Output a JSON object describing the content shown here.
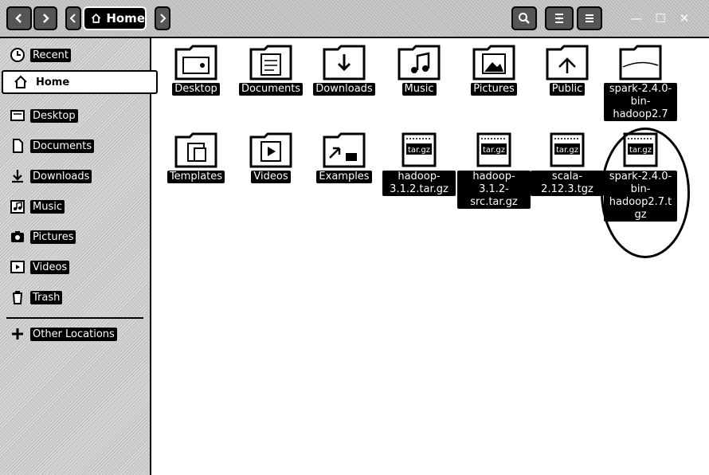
{
  "header": {
    "location_label": "Home",
    "window_controls": [
      "—",
      "☐",
      "✕"
    ]
  },
  "sidebar": {
    "items": [
      {
        "label": "Recent",
        "icon": "clock-icon"
      },
      {
        "label": "Home",
        "icon": "home-icon"
      },
      {
        "label": "Desktop",
        "icon": "desktop-folder-icon"
      },
      {
        "label": "Documents",
        "icon": "document-icon"
      },
      {
        "label": "Downloads",
        "icon": "download-icon"
      },
      {
        "label": "Music",
        "icon": "music-icon"
      },
      {
        "label": "Pictures",
        "icon": "camera-icon"
      },
      {
        "label": "Videos",
        "icon": "video-icon"
      },
      {
        "label": "Trash",
        "icon": "trash-icon"
      }
    ],
    "other_locations": "Other Locations"
  },
  "files": [
    {
      "name": "Desktop",
      "kind": "folder"
    },
    {
      "name": "Documents",
      "kind": "folder"
    },
    {
      "name": "Downloads",
      "kind": "folder"
    },
    {
      "name": "Music",
      "kind": "folder"
    },
    {
      "name": "Pictures",
      "kind": "folder"
    },
    {
      "name": "Public",
      "kind": "folder"
    },
    {
      "name": "spark-2.4.0-bin-hadoop2.7",
      "kind": "folder"
    },
    {
      "name": "Templates",
      "kind": "folder"
    },
    {
      "name": "Videos",
      "kind": "folder"
    },
    {
      "name": "Examples",
      "kind": "folder"
    },
    {
      "name": "hadoop-3.1.2.tar.gz",
      "kind": "archive",
      "badge": "tar.gz"
    },
    {
      "name": "hadoop-3.1.2-src.tar.gz",
      "kind": "archive",
      "badge": "tar.gz"
    },
    {
      "name": "scala-2.12.3.tgz",
      "kind": "archive",
      "badge": "tar.gz"
    },
    {
      "name": "spark-2.4.0-bin-hadoop2.7.tgz",
      "kind": "archive",
      "badge": "tar.gz"
    }
  ]
}
